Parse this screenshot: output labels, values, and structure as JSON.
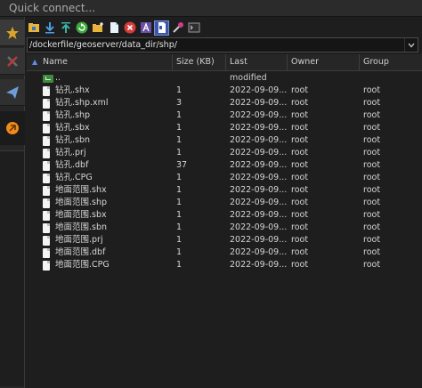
{
  "quick_connect": {
    "placeholder": "Quick connect..."
  },
  "path": {
    "value": "/dockerfile/geoserver/data_dir/shp/"
  },
  "columns": {
    "name": "Name",
    "size": "Size (KB)",
    "modified": "Last modified",
    "owner": "Owner",
    "group": "Group"
  },
  "left_strip": [
    "star-icon",
    "sftp-tools-icon",
    "send-icon",
    "macro-icon"
  ],
  "toolbar": [
    "folder-open-icon",
    "download-icon",
    "upload-icon",
    "refresh-icon",
    "new-folder-icon",
    "new-file-icon",
    "delete-icon",
    "text-mode-icon",
    "show-hidden-icon",
    "properties-icon",
    "terminal-icon"
  ],
  "files": [
    {
      "name": "..",
      "size": "",
      "modified": "",
      "owner": "",
      "group": "",
      "type": "parent"
    },
    {
      "name": "钻孔.shx",
      "size": "1",
      "modified": "2022-09-09...",
      "owner": "root",
      "group": "root",
      "type": "file"
    },
    {
      "name": "钻孔.shp.xml",
      "size": "3",
      "modified": "2022-09-09...",
      "owner": "root",
      "group": "root",
      "type": "file"
    },
    {
      "name": "钻孔.shp",
      "size": "1",
      "modified": "2022-09-09...",
      "owner": "root",
      "group": "root",
      "type": "file"
    },
    {
      "name": "钻孔.sbx",
      "size": "1",
      "modified": "2022-09-09...",
      "owner": "root",
      "group": "root",
      "type": "file"
    },
    {
      "name": "钻孔.sbn",
      "size": "1",
      "modified": "2022-09-09...",
      "owner": "root",
      "group": "root",
      "type": "file"
    },
    {
      "name": "钻孔.prj",
      "size": "1",
      "modified": "2022-09-09...",
      "owner": "root",
      "group": "root",
      "type": "file"
    },
    {
      "name": "钻孔.dbf",
      "size": "37",
      "modified": "2022-09-09...",
      "owner": "root",
      "group": "root",
      "type": "file"
    },
    {
      "name": "钻孔.CPG",
      "size": "1",
      "modified": "2022-09-09...",
      "owner": "root",
      "group": "root",
      "type": "file"
    },
    {
      "name": "地面范围.shx",
      "size": "1",
      "modified": "2022-09-09...",
      "owner": "root",
      "group": "root",
      "type": "file"
    },
    {
      "name": "地面范围.shp",
      "size": "1",
      "modified": "2022-09-09...",
      "owner": "root",
      "group": "root",
      "type": "file"
    },
    {
      "name": "地面范围.sbx",
      "size": "1",
      "modified": "2022-09-09...",
      "owner": "root",
      "group": "root",
      "type": "file"
    },
    {
      "name": "地面范围.sbn",
      "size": "1",
      "modified": "2022-09-09...",
      "owner": "root",
      "group": "root",
      "type": "file"
    },
    {
      "name": "地面范围.prj",
      "size": "1",
      "modified": "2022-09-09...",
      "owner": "root",
      "group": "root",
      "type": "file"
    },
    {
      "name": "地面范围.dbf",
      "size": "1",
      "modified": "2022-09-09...",
      "owner": "root",
      "group": "root",
      "type": "file"
    },
    {
      "name": "地面范围.CPG",
      "size": "1",
      "modified": "2022-09-09...",
      "owner": "root",
      "group": "root",
      "type": "file"
    }
  ]
}
